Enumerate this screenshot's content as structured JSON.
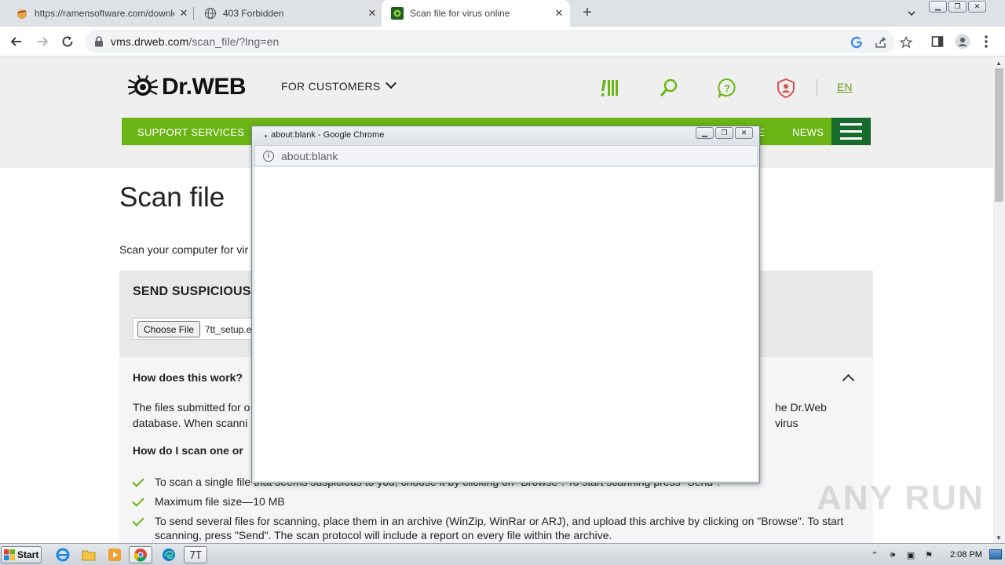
{
  "browser": {
    "tabs": [
      {
        "title": "https://ramensoftware.com/downloa",
        "icon": "ramen-favicon"
      },
      {
        "title": "403 Forbidden",
        "icon": "globe-icon"
      },
      {
        "title": "Scan file for virus online",
        "icon": "drweb-favicon"
      }
    ],
    "url_host": "vms.drweb.com",
    "url_path": "/scan_file/?lng=en"
  },
  "site": {
    "logo": "Dr.WEB",
    "for_customers": "FOR CUSTOMERS",
    "lang": "EN",
    "nav": {
      "support": "SUPPORT SERVICES",
      "partial_e": "E",
      "news": "NEWS"
    },
    "title": "Scan file",
    "intro": "Scan your computer for vir",
    "send_title": "SEND SUSPICIOUS",
    "choose_file": "Choose File",
    "file_name": "7tt_setup.e",
    "faq": {
      "q1": "How does this work?",
      "p1_left": "The files submitted for o",
      "p1_right": "he Dr.Web virus",
      "p2_left": "database. When scanni",
      "q2": "How do I scan one or",
      "items": [
        "To scan a single file that seems suspicious to you, choose it by clicking on \"Browse\". To start scanning press \"Send\".",
        "Maximum file size—10 MB",
        "To send several files for scanning, place them in an archive (WinZip, WinRar or ARJ), and upload this archive by clicking on \"Browse\". To start scanning, press \"Send\". The scan protocol will include a report on every file within the archive."
      ]
    }
  },
  "popup": {
    "title": "about:blank - Google Chrome",
    "url": "about:blank"
  },
  "watermark": "ANY RUN",
  "taskbar": {
    "start": "Start",
    "clock": "2:08 PM"
  },
  "colors": {
    "green": "#6ab515",
    "dark_green": "#166b2d"
  }
}
